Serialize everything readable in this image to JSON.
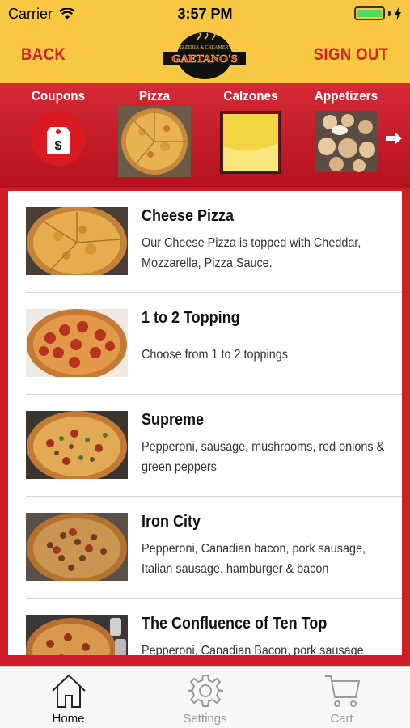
{
  "status": {
    "carrier": "Carrier",
    "time": "3:57 PM"
  },
  "header": {
    "back_label": "BACK",
    "signout_label": "SIGN OUT",
    "logo_text": "GAETANO'S",
    "logo_subtext": "PIZZERIA & CREAMERY"
  },
  "categories": [
    {
      "label": "Coupons",
      "icon": "coupon-tag-icon"
    },
    {
      "label": "Pizza",
      "icon": "pizza-image"
    },
    {
      "label": "Calzones",
      "icon": "calzone-image"
    },
    {
      "label": "Appetizers",
      "icon": "appetizers-image"
    }
  ],
  "menu_items": [
    {
      "title": "Cheese Pizza",
      "description": "Our Cheese Pizza is topped with Cheddar, Mozzarella, Pizza Sauce."
    },
    {
      "title": "1 to 2 Topping",
      "description": "Choose from 1 to 2 toppings"
    },
    {
      "title": "Supreme",
      "description": "Pepperoni, sausage, mushrooms, red onions & green peppers"
    },
    {
      "title": "Iron City",
      "description": "Pepperoni, Canadian bacon, pork sausage, Italian sausage, hamburger & bacon"
    },
    {
      "title": "The Confluence of Ten Top",
      "description": "Pepperoni, Canadian Bacon, pork sausage"
    }
  ],
  "tabs": [
    {
      "label": "Home",
      "icon": "home-icon",
      "active": true
    },
    {
      "label": "Settings",
      "icon": "gear-icon",
      "active": false
    },
    {
      "label": "Cart",
      "icon": "cart-icon",
      "active": false
    }
  ],
  "colors": {
    "header_yellow": "#f8c842",
    "brand_red": "#d4202c",
    "battery_green": "#4cd964"
  }
}
